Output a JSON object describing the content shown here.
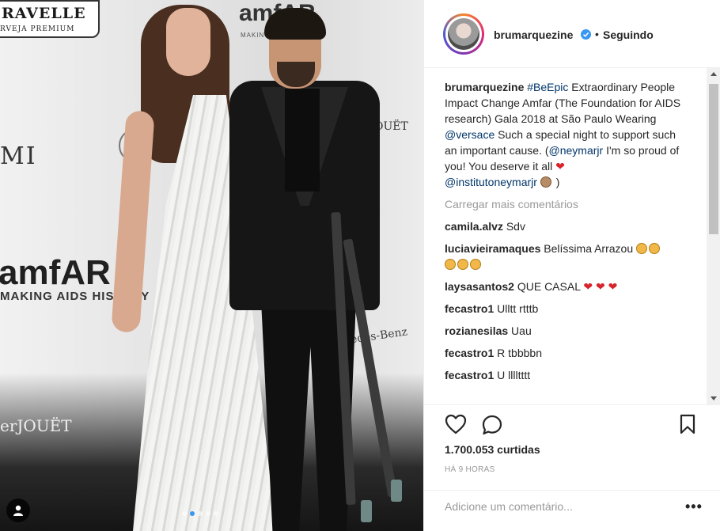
{
  "photo": {
    "backdrop_brand_banner": "RAVELLE",
    "backdrop_brand_sub": "RVEJA PREMIUM",
    "backdrop_amfar_top": "amfAR",
    "backdrop_amfar_top_sub": "MAKING",
    "backdrop_amfar_big": "amfAR",
    "backdrop_amfar_big_sub": "MAKING AIDS HISTORY",
    "backdrop_mi": "MI",
    "backdrop_jouet_top": "r-JOUËT",
    "backdrop_jouet_bottom": "erJOUËT",
    "backdrop_mercedes": "ercedes-Benz",
    "carousel_total": 5,
    "carousel_active": 1
  },
  "header": {
    "username": "brumarquezine",
    "separator": "•",
    "follow_status": "Seguindo"
  },
  "caption": {
    "username": "brumarquezine",
    "hashtag": "#BeEpic",
    "text_1": " Extraordinary People Impact Change Amfar (The Foundation for AIDS research) Gala 2018 at São Paulo Wearing ",
    "mention_versace": "@versace",
    "text_2": " Such a special night to support such an important cause. (",
    "mention_neymar": "@neymarjr",
    "text_3": " I'm so proud of you! You deserve it all ",
    "heart": "❤",
    "mention_instituto": "@institutoneymarjr",
    "text_4": " )"
  },
  "load_more": "Carregar mais comentários",
  "comments": [
    {
      "user": "camila.alvz",
      "text": "Sdv"
    },
    {
      "user": "luciavieiramaques",
      "text": "Belíssima Arrazou"
    },
    {
      "user": "laysasantos2",
      "text": "QUE CASAL"
    },
    {
      "user": "fecastro1",
      "text": "Ulltt rtttb"
    },
    {
      "user": "rozianesilas",
      "text": "Uau"
    },
    {
      "user": "fecastro1",
      "text": "R tbbbbn"
    },
    {
      "user": "fecastro1",
      "text": "U lllltttt"
    }
  ],
  "hearts_laysa": "❤ ❤ ❤",
  "likes": "1.700.053 curtidas",
  "time_ago": "HÁ 9 HORAS",
  "add_comment_placeholder": "Adicione um comentário...",
  "more_options": "•••",
  "colors": {
    "link": "#003569",
    "verified": "#3897f0",
    "heart": "#d8242c",
    "muted": "#999999",
    "text": "#262626"
  },
  "icons": [
    "tag-user-icon",
    "verified-icon",
    "heart-icon",
    "comment-icon",
    "bookmark-icon"
  ]
}
